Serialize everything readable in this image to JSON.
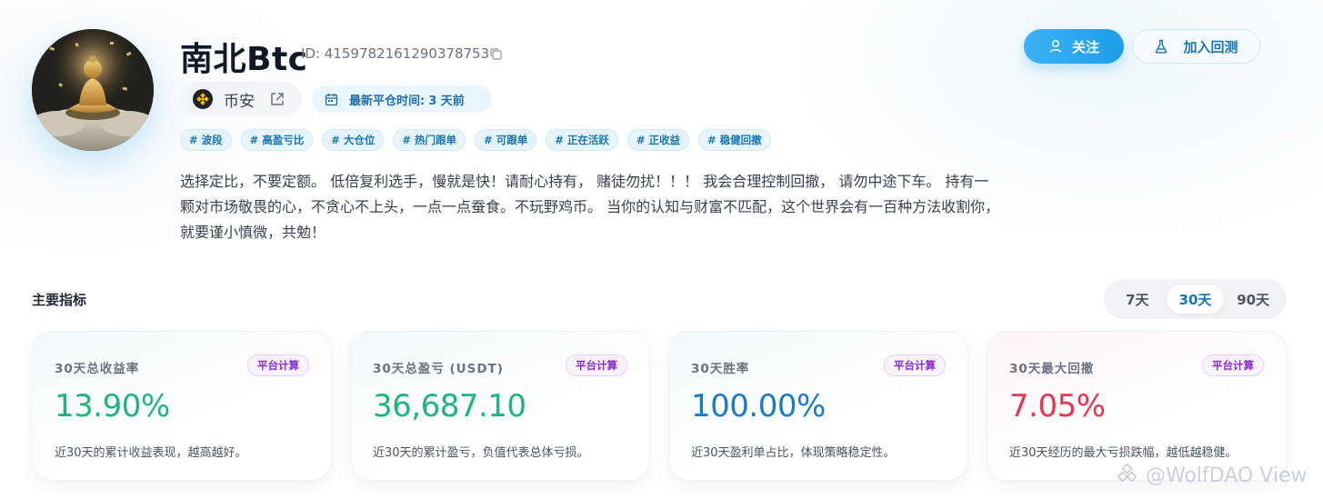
{
  "profile": {
    "name": "南北Btc",
    "id_text": "ID: 4159782161290378753",
    "exchange": "币安",
    "last_close_label": "最新平仓时间:",
    "last_close_value": "3 天前",
    "tags": [
      "# 波段",
      "# 高盈亏比",
      "# 大仓位",
      "# 热门跟单",
      "# 可跟单",
      "# 正在活跃",
      "# 正收益",
      "# 稳健回撤"
    ],
    "bio": "选择定比，不要定额。 低倍复利选手，慢就是快！请耐心持有， 赌徒勿扰！！！ 我会合理控制回撤， 请勿中途下车。 持有一颗对市场敬畏的心，不贪心不上头，一点一点蚕食。不玩野鸡币。 当你的认知与财富不匹配，这个世界会有一百种方法收割你，就要谨小慎微，共勉！"
  },
  "actions": {
    "follow": "关注",
    "backtest": "加入回测"
  },
  "metrics": {
    "title": "主要指标",
    "periods": [
      "7天",
      "30天",
      "90天"
    ],
    "active_period": "30天",
    "cards": [
      {
        "label": "30天总收益率",
        "badge": "平台计算",
        "value": "13.90%",
        "desc": "近30天的累计收益表现，越高越好。",
        "color": "#1fb57a"
      },
      {
        "label": "30天总盈亏 (USDT)",
        "badge": "平台计算",
        "value": "36,687.10",
        "desc": "近30天的累计盈亏，负值代表总体亏损。",
        "color": "#1fb57a"
      },
      {
        "label": "30天胜率",
        "badge": "平台计算",
        "value": "100.00%",
        "desc": "近30天盈利单占比，体现策略稳定性。",
        "color": "#1b7bc4"
      },
      {
        "label": "30天最大回撤",
        "badge": "平台计算",
        "value": "7.05%",
        "desc": "近30天经历的最大亏损跌幅，越低越稳健。",
        "color": "#e8344f"
      }
    ]
  },
  "watermark": "@WolfDAO View",
  "colors": {
    "accent": "#1e9de9",
    "tag_text": "#1976b5",
    "badge_text": "#8a2bd0"
  }
}
